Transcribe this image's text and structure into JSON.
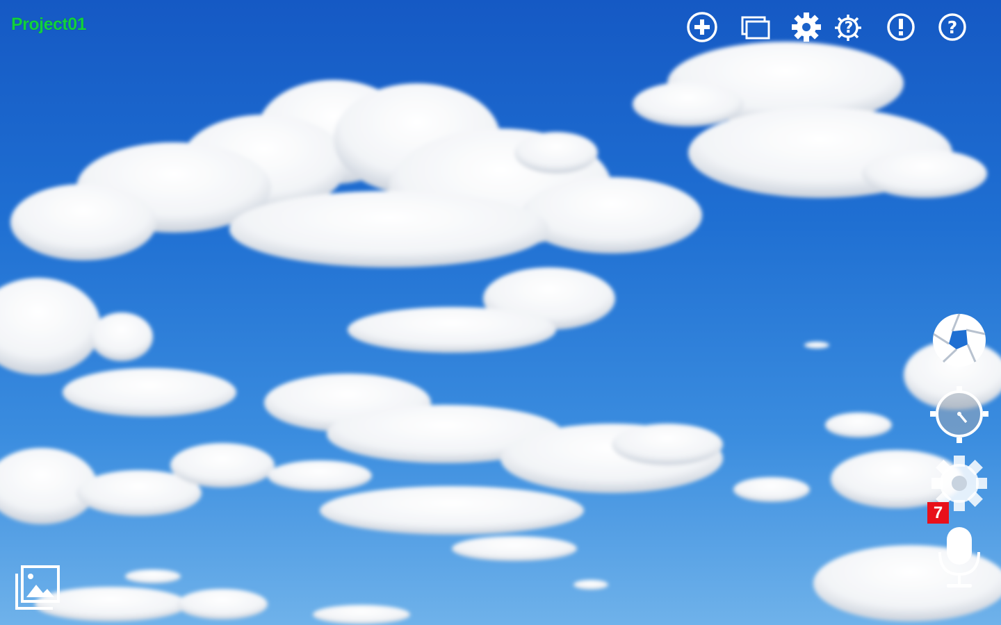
{
  "project": {
    "title": "Project01"
  },
  "toolbar": {
    "buttons": [
      {
        "icon": "add-circle-icon"
      },
      {
        "icon": "windows-icon"
      },
      {
        "icon": "gear-icon"
      },
      {
        "icon": "help-settings-icon"
      },
      {
        "icon": "alert-circle-icon"
      },
      {
        "icon": "question-circle-icon"
      }
    ]
  },
  "side_tools": {
    "buttons": [
      {
        "icon": "shutter-icon"
      },
      {
        "icon": "timer-icon"
      },
      {
        "icon": "settings-gear-icon"
      },
      {
        "icon": "microphone-icon"
      }
    ],
    "settings_badge": "7"
  },
  "gallery": {
    "icon": "gallery-icon"
  },
  "colors": {
    "title": "#10d23c",
    "badge": "#e8101a",
    "icon": "#ffffff",
    "sky_top": "#1559c4",
    "sky_bottom": "#6fb2ea"
  }
}
